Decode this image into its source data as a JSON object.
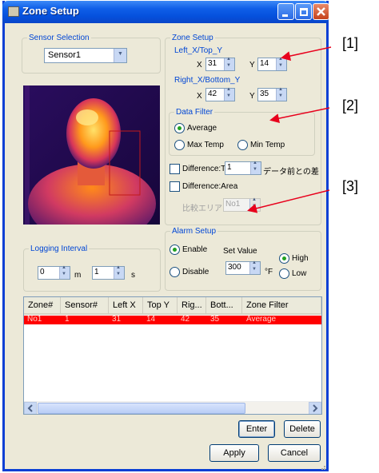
{
  "window": {
    "title": "Zone Setup"
  },
  "sensor_selection": {
    "legend": "Sensor Selection",
    "selected": "Sensor1"
  },
  "zone_setup": {
    "legend": "Zone Setup",
    "left_top_label": "Left_X/Top_Y",
    "right_bottom_label": "Right_X/Bottom_Y",
    "x_label": "X",
    "y_label": "Y",
    "left_x": "31",
    "top_y": "14",
    "right_x": "42",
    "bottom_y": "35"
  },
  "data_filter": {
    "legend": "Data Filter",
    "options": [
      "Average",
      "Max Temp",
      "Min Temp"
    ],
    "selected": "Average"
  },
  "difference": {
    "temp_label": "Difference:T",
    "temp_value": "1",
    "temp_suffix": "データ前との差",
    "area_label": "Difference:Area",
    "compare_area_label": "比較エリア",
    "compare_area_value": "No1"
  },
  "logging": {
    "legend": "Logging Interval",
    "minutes": "0",
    "minutes_unit": "m",
    "seconds": "1",
    "seconds_unit": "s"
  },
  "alarm": {
    "legend": "Alarm Setup",
    "enable_label": "Enable",
    "disable_label": "Disable",
    "set_value_label": "Set Value",
    "set_value": "300",
    "unit": "°F",
    "high_label": "High",
    "low_label": "Low"
  },
  "table": {
    "columns": [
      "Zone#",
      "Sensor#",
      "Left X",
      "Top Y",
      "Rig...",
      "Bott...",
      "Zone Filter"
    ],
    "rows": [
      [
        "No1",
        "1",
        "31",
        "14",
        "42",
        "35",
        "Average"
      ]
    ]
  },
  "buttons": {
    "enter": "Enter",
    "delete": "Delete",
    "apply": "Apply",
    "cancel": "Cancel"
  },
  "annotations": [
    "[1]",
    "[2]",
    "[3]"
  ],
  "colors": {
    "title_bar": "#0a45c8",
    "selected_row": "#ff0000",
    "accent_legend": "#0046d5",
    "annotation_arrow": "#e8001c"
  }
}
